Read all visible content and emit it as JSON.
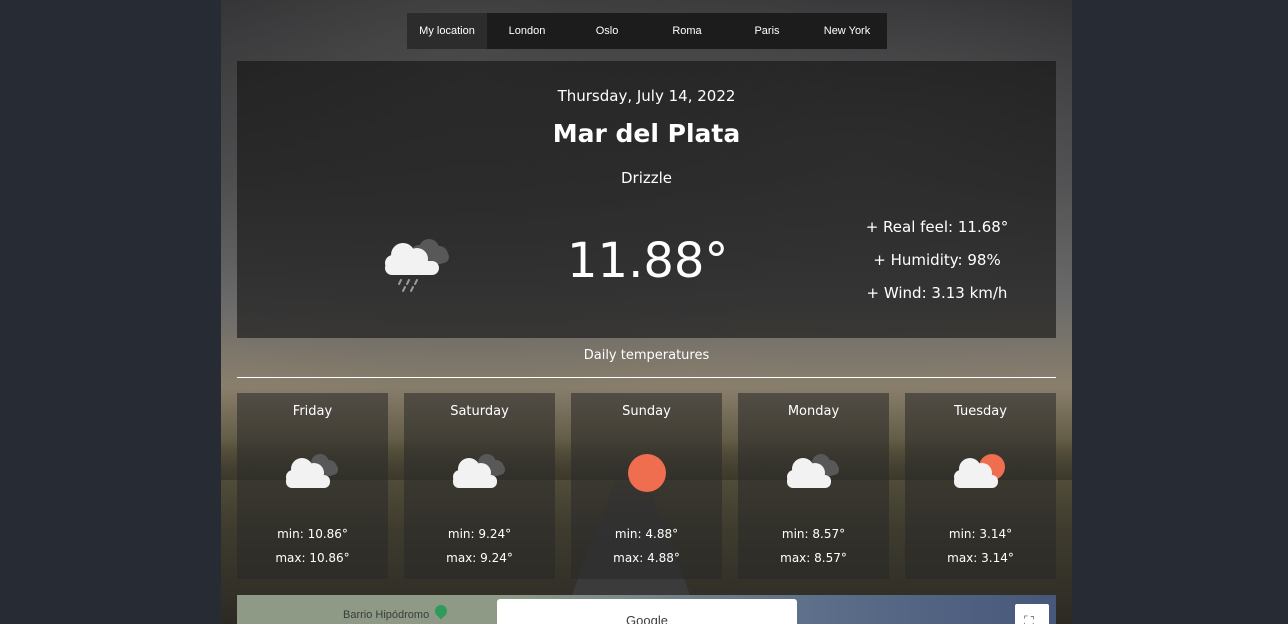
{
  "nav": {
    "tabs": [
      {
        "label": "My location",
        "active": true
      },
      {
        "label": "London",
        "active": false
      },
      {
        "label": "Oslo",
        "active": false
      },
      {
        "label": "Roma",
        "active": false
      },
      {
        "label": "Paris",
        "active": false
      },
      {
        "label": "New York",
        "active": false
      }
    ]
  },
  "current": {
    "date": "Thursday, July 14, 2022",
    "city": "Mar del Plata",
    "condition": "Drizzle",
    "temperature": "11.88°",
    "icon": "drizzle-cloud-icon",
    "details": {
      "real_feel": "+ Real feel: 11.68°",
      "humidity": "+ Humidity: 98%",
      "wind": "+ Wind: 3.13 km/h"
    }
  },
  "daily": {
    "title": "Daily temperatures",
    "days": [
      {
        "day": "Friday",
        "icon": "cloudy-icon",
        "min": "min: 10.86°",
        "max": "max: 10.86°"
      },
      {
        "day": "Saturday",
        "icon": "cloudy-icon",
        "min": "min: 9.24°",
        "max": "max: 9.24°"
      },
      {
        "day": "Sunday",
        "icon": "sun-icon",
        "min": "min: 4.88°",
        "max": "max: 4.88°"
      },
      {
        "day": "Monday",
        "icon": "cloudy-icon",
        "min": "min: 8.57°",
        "max": "max: 8.57°"
      },
      {
        "day": "Tuesday",
        "icon": "partly-cloudy-icon",
        "min": "min: 3.14°",
        "max": "max: 3.14°"
      }
    ]
  },
  "map": {
    "place_label": "Barrio Hipódromo",
    "dialog_title": "Google"
  },
  "colors": {
    "sun": "#ee6e4f",
    "cloud": "#f2f2f2",
    "cloud_dark": "#585858"
  }
}
